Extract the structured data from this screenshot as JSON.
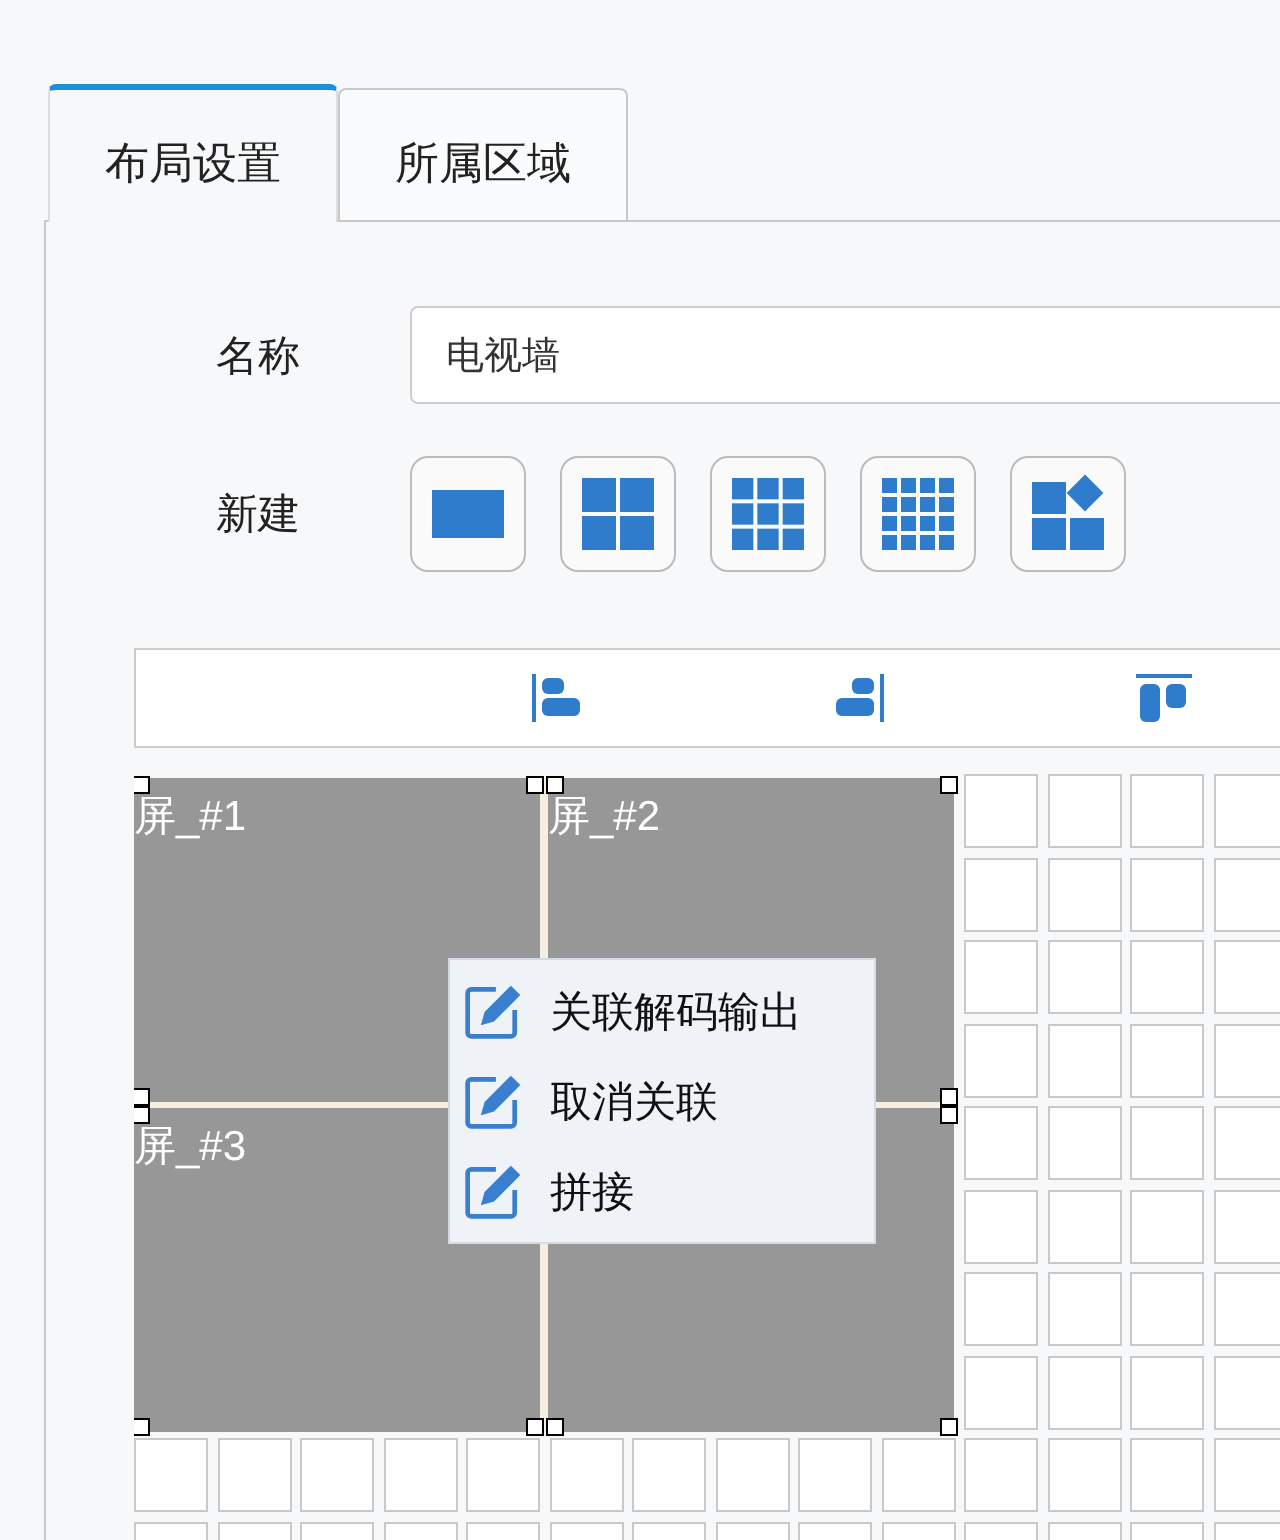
{
  "tabs": [
    {
      "label": "布局设置",
      "selected": true
    },
    {
      "label": "所属区域",
      "selected": false
    }
  ],
  "name_field": {
    "label": "名称",
    "value": "电视墙"
  },
  "new_layout": {
    "label": "新建",
    "options": [
      {
        "kind": "single"
      },
      {
        "kind": "quad"
      },
      {
        "kind": "nine"
      },
      {
        "kind": "sixteen"
      },
      {
        "kind": "mixed"
      }
    ]
  },
  "align_tools": [
    {
      "kind": "left"
    },
    {
      "kind": "right"
    },
    {
      "kind": "top"
    }
  ],
  "screens": [
    {
      "label": "屏_#1",
      "selected": true
    },
    {
      "label": "屏_#2",
      "selected": true
    },
    {
      "label": "屏_#3",
      "selected": true
    },
    {
      "selected": true
    }
  ],
  "context_menu": [
    {
      "label": "关联解码输出"
    },
    {
      "label": "取消关联"
    },
    {
      "label": "拼接"
    }
  ]
}
